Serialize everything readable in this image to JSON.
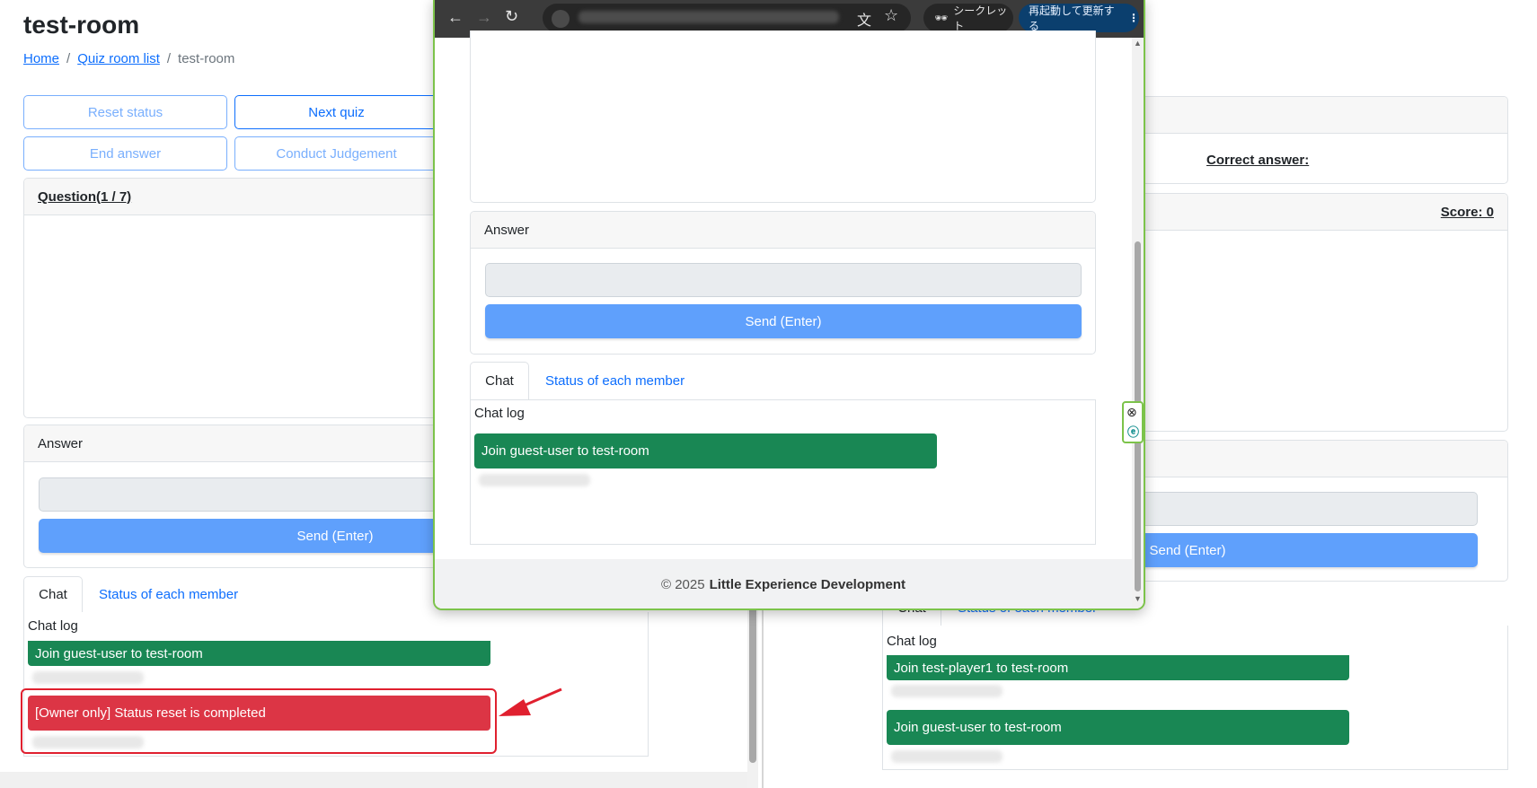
{
  "left": {
    "title": "test-room",
    "breadcrumb": {
      "home": "Home",
      "sep1": "/",
      "list": "Quiz room list",
      "sep2": "/",
      "current": "test-room"
    },
    "buttons": {
      "reset": "Reset status",
      "next": "Next quiz",
      "end": "End answer",
      "judge": "Conduct Judgement"
    },
    "question_header": "Question(1 / 7)",
    "answer_header": "Answer",
    "send_label": "Send (Enter)",
    "tabs": {
      "chat": "Chat",
      "status": "Status of each member"
    },
    "chat_log_label": "Chat log",
    "messages": {
      "join": "Join guest-user to test-room",
      "reset": "[Owner only] Status reset is completed"
    }
  },
  "right": {
    "correct_answer_label": "Correct answer:",
    "score_label": "Score: 0",
    "send_label": "Send (Enter)",
    "tabs": {
      "chat": "Chat",
      "status": "Status of each member"
    },
    "chat_log_label": "Chat log",
    "messages": {
      "join1": "Join test-player1 to test-room",
      "join2": "Join guest-user to test-room"
    }
  },
  "popup": {
    "toolbar": {
      "incognito": "シークレット",
      "restart": "再起動して更新する"
    },
    "answer_header": "Answer",
    "send_label": "Send (Enter)",
    "tabs": {
      "chat": "Chat",
      "status": "Status of each member"
    },
    "chat_log_label": "Chat log",
    "messages": {
      "join": "Join guest-user to test-room"
    },
    "footer": {
      "copyright": "© 2025",
      "company": "Little Experience Development"
    }
  },
  "colors": {
    "primary": "#0d6efd",
    "send": "#5fa0fc",
    "success": "#198754",
    "danger": "#dc3545",
    "highlight": "#e0202f",
    "browser_frame": "#7cc34a"
  },
  "icons": [
    "back-arrow-icon",
    "forward-arrow-icon",
    "reload-icon",
    "site-info-icon",
    "translate-icon",
    "star-icon",
    "incognito-icon",
    "more-icon",
    "close-circle-icon",
    "extension-icon",
    "red-arrow-icon"
  ]
}
